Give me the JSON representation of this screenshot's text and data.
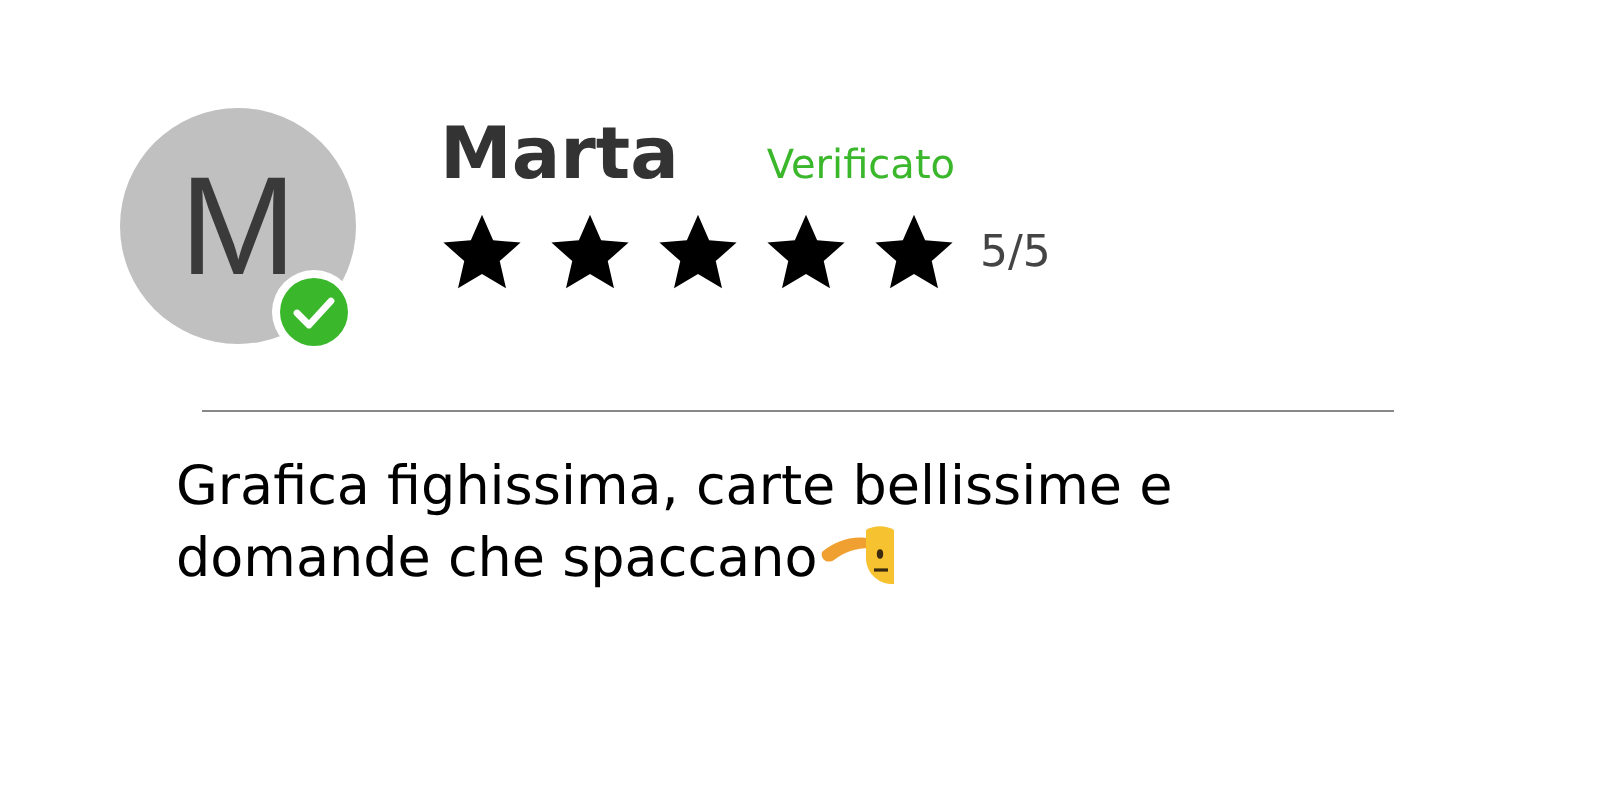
{
  "reviewer": {
    "initial": "M",
    "name": "Marta",
    "verified": true,
    "badge": "Verificato",
    "stars": 5,
    "rating": "5/5"
  },
  "review": {
    "text": "Grafica fighissima, carte bellissime e domande che spaccano"
  }
}
